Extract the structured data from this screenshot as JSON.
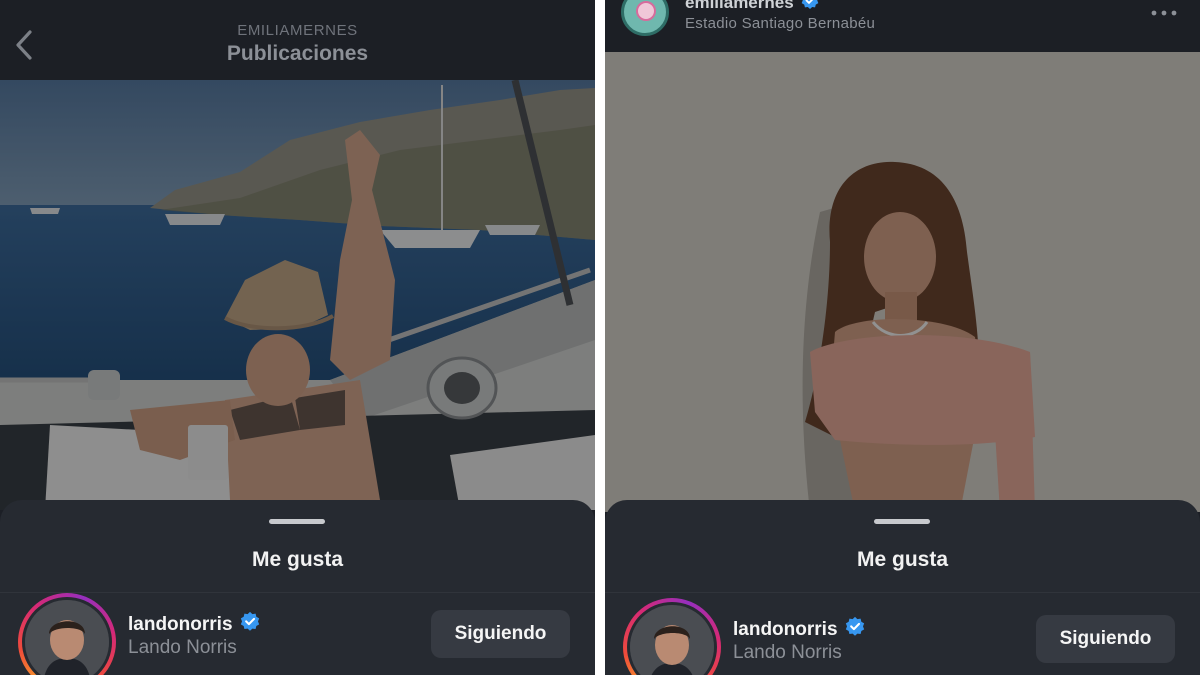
{
  "colors": {
    "app_background": "#1c1f26",
    "sheet_background": "#262a31",
    "follow_button": "#363a42",
    "verified_badge": "#3797f0",
    "divider": "#ffffff"
  },
  "left_screen": {
    "header": {
      "username": "EMILIAMERNES",
      "title": "Publicaciones",
      "back_icon": "chevron-left-icon"
    },
    "likes_sheet": {
      "title": "Me gusta",
      "likes": [
        {
          "username": "landonorris",
          "verified": true,
          "full_name": "Lando Norris",
          "button_label": "Siguiendo"
        }
      ]
    }
  },
  "right_screen": {
    "post_header": {
      "username": "emiliamernes",
      "verified": true,
      "location": "Estadio Santiago Bernabéu",
      "more_icon": "more-horizontal-icon"
    },
    "likes_sheet": {
      "title": "Me gusta",
      "likes": [
        {
          "username": "landonorris",
          "verified": true,
          "full_name": "Lando Norris",
          "button_label": "Siguiendo"
        }
      ]
    }
  }
}
